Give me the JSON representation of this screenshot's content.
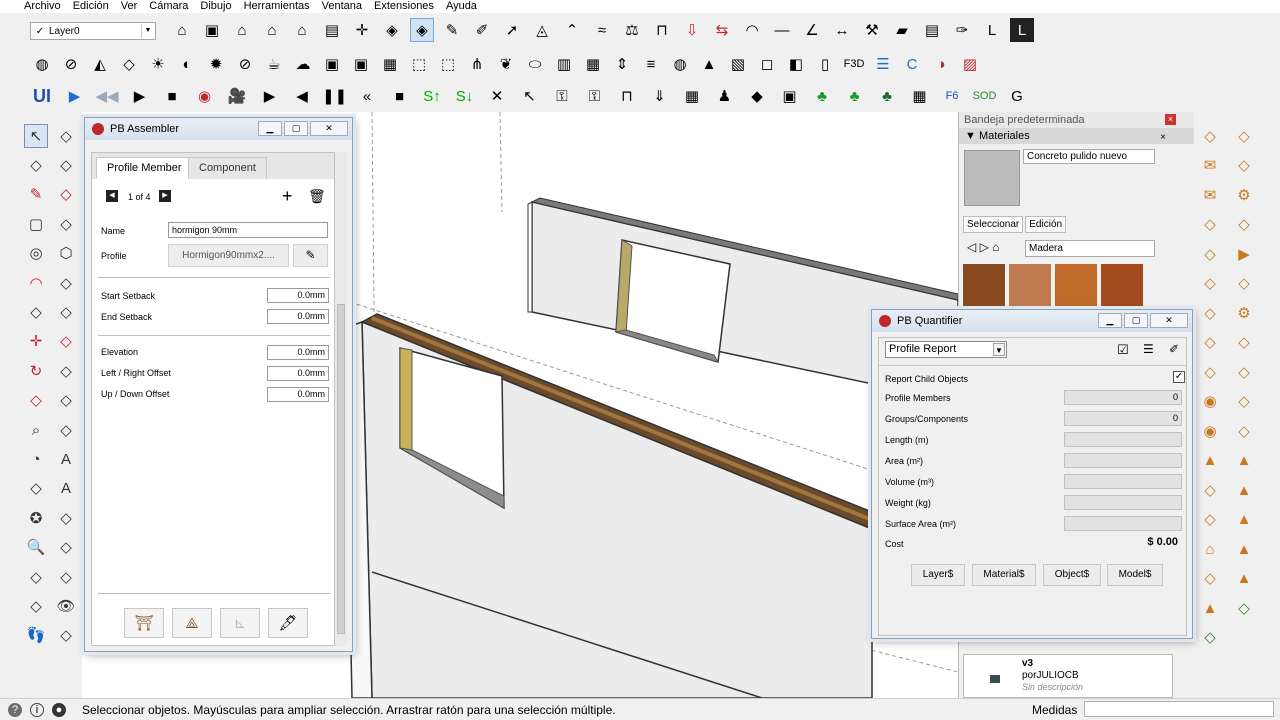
{
  "menubar": [
    "Archivo",
    "Edición",
    "Ver",
    "Cámara",
    "Dibujo",
    "Herramientas",
    "Ventana",
    "Extensiones",
    "Ayuda"
  ],
  "layer_select": {
    "value": "Layer0"
  },
  "toolbar_icons": {
    "row1": [
      "warehouse-icon",
      "box-icon",
      "home-icon",
      "house-icon",
      "house-alt-icon",
      "folder-icon",
      "axis-icon",
      "component-icon",
      "component-selected-icon",
      "pencil-icon",
      "brush-icon",
      "arrow-icon",
      "paint-bucket-icon",
      "roof-icon",
      "wave-icon",
      "scale-icon",
      "door-icon",
      "push-pull-icon",
      "move-icon",
      "arc-icon",
      "line-icon",
      "angle-icon",
      "dimension-icon",
      "wrench-icon",
      "lumber-icon",
      "save-icon",
      "script-icon",
      "layout-icon",
      "sketchup-icon"
    ],
    "row2": [
      "sphere-grid-icon",
      "no-icon",
      "lamp-icon",
      "shield-icon",
      "sun-icon",
      "half-circle-icon",
      "sun-alt-icon",
      "eraser-circle-icon",
      "kettle-icon",
      "cloud-icon",
      "window-icon",
      "window-alt-icon",
      "grid-icon",
      "cube-wire-icon",
      "cube-alt-icon",
      "grass-icon",
      "leaf-icon",
      "egg-icon",
      "book-icon",
      "tile-icon",
      "arrows-icon",
      "stack-icon",
      "bag-icon",
      "paint-icon",
      "map-icon",
      "cube-outline-icon",
      "cube-blue-icon",
      "panel-icon",
      "f3d-icon",
      "list-icon",
      "c-icon",
      "pie-icon",
      "hatch-icon"
    ],
    "row3": [
      "ui-icon",
      "play-icon",
      "rewind-icon",
      "forward-2-icon",
      "stop-icon",
      "record-icon",
      "camera-icon",
      "play-gray-icon",
      "back-gray-icon",
      "pause-gray-icon",
      "rewind-gray-icon",
      "stop-gray-icon",
      "s-up-icon",
      "s-down-icon",
      "x-icon",
      "cursor-icon",
      "lock-icon",
      "lock-alt-icon",
      "door-alt-icon",
      "download-icon",
      "blocks-icon",
      "person-icon",
      "osm-icon",
      "photo-icon",
      "tree-icon",
      "tree-alt-icon",
      "tree-dark-icon",
      "grid-alt-icon",
      "f6-icon",
      "sod-icon",
      "g-icon"
    ]
  },
  "assembler": {
    "title": "PB Assembler",
    "tabs": [
      "Profile Member",
      "Component"
    ],
    "pager": "1 of 4",
    "name_label": "Name",
    "name_value": "hormigon 90mm",
    "profile_label": "Profile",
    "profile_value": "Hormigon90mmx2....",
    "fields": [
      {
        "label": "Start Setback",
        "value": "0.0mm"
      },
      {
        "label": "End Setback",
        "value": "0.0mm"
      },
      {
        "label": "Elevation",
        "value": "0.0mm"
      },
      {
        "label": "Left / Right Offset",
        "value": "0.0mm"
      },
      {
        "label": "Up / Down Offset",
        "value": "0.0mm"
      }
    ]
  },
  "quantifier": {
    "title": "PB Quantifier",
    "report": "Profile Report",
    "rows": [
      {
        "label": "Report Child Objects",
        "value": ""
      },
      {
        "label": "Profile Members",
        "value": "0"
      },
      {
        "label": "Groups/Components",
        "value": "0"
      },
      {
        "label": "Length (m)",
        "value": ""
      },
      {
        "label": "Area (m²)",
        "value": ""
      },
      {
        "label": "Volume (m³)",
        "value": ""
      },
      {
        "label": "Weight (kg)",
        "value": ""
      },
      {
        "label": "Surface Area (m²)",
        "value": ""
      }
    ],
    "cost_label": "Cost",
    "cost_value": "$ 0.00",
    "buttons": [
      "Layer$",
      "Material$",
      "Object$",
      "Model$"
    ]
  },
  "tray": {
    "title": "Bandeja predeterminada",
    "materials_header": "Materiales",
    "material_name": "Concreto pulido nuevo",
    "tabs": [
      "Seleccionar",
      "Edición"
    ],
    "library": "Madera",
    "component": {
      "name": "v3",
      "author": "porJULIOCB",
      "desc": "Sin descripción"
    }
  },
  "status": {
    "text": "Seleccionar objetos. Mayúsculas para ampliar selección. Arrastrar ratón para una selección múltiple.",
    "measure_label": "Medidas"
  },
  "colors": {
    "accent": "#c0262d",
    "wood": "#b0622a",
    "wall_edge": "#333333"
  }
}
